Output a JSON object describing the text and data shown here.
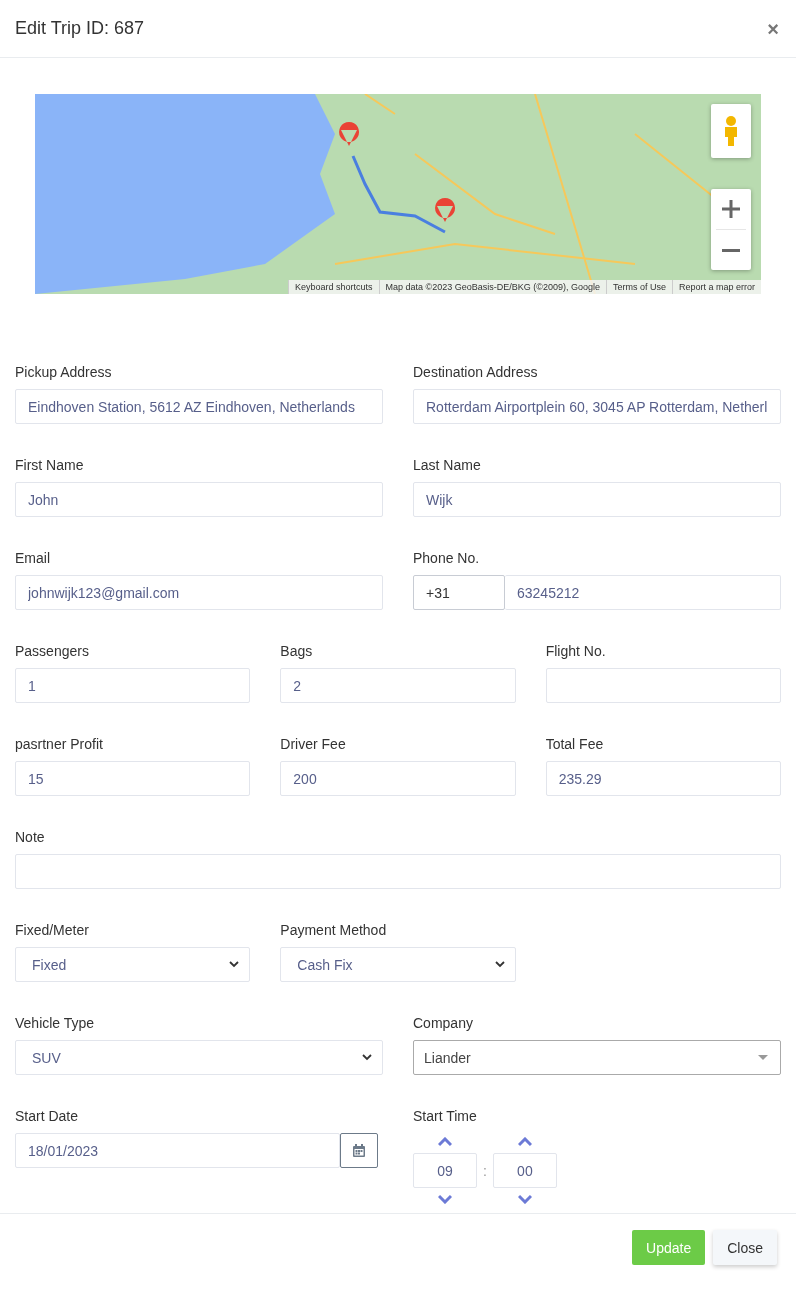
{
  "dialog": {
    "title": "Edit Trip ID: 687",
    "close": "×"
  },
  "map": {
    "attribution": [
      "Keyboard shortcuts",
      "Map data ©2023 GeoBasis-DE/BKG (©2009), Google",
      "Terms of Use",
      "Report a map error"
    ]
  },
  "rows": [
    [
      {
        "label": "Pickup Address",
        "kind": "text",
        "value": "Eindhoven Station, 5612 AZ Eindhoven, Netherlands"
      },
      {
        "label": "Destination Address",
        "kind": "text",
        "value": "Rotterdam Airportplein 60, 3045 AP Rotterdam, Netherl"
      }
    ],
    [
      {
        "label": "First Name",
        "kind": "text",
        "value": "John"
      },
      {
        "label": "Last Name",
        "kind": "text",
        "value": "Wijk"
      }
    ],
    [
      {
        "label": "Email",
        "kind": "text",
        "value": "johnwijk123@gmail.com"
      },
      {
        "label": "Phone No.",
        "kind": "phone",
        "code": "+31",
        "value": "63245212"
      }
    ],
    [
      {
        "label": "Passengers",
        "kind": "text",
        "value": "1"
      },
      {
        "label": "Bags",
        "kind": "text",
        "value": "2"
      },
      {
        "label": "Flight No.",
        "kind": "text"
      }
    ],
    [
      {
        "label": "pasrtner Profit",
        "kind": "text",
        "value": "15"
      },
      {
        "label": "Driver Fee",
        "kind": "text",
        "value": "200"
      },
      {
        "label": "Total Fee",
        "kind": "text",
        "value": "235.29"
      }
    ],
    [
      {
        "label": "Note",
        "kind": "text"
      }
    ],
    [
      {
        "label": "Fixed/Meter",
        "kind": "select",
        "value": "Fixed"
      },
      {
        "label": "Payment Method",
        "kind": "select",
        "value": "Cash Fix"
      }
    ],
    [
      {
        "label": "Vehicle Type",
        "kind": "select",
        "value": "SUV"
      },
      {
        "label": "Company",
        "kind": "combo",
        "value": "Liander"
      }
    ],
    [
      {
        "label": "Start Date",
        "kind": "date",
        "value": "18/01/2023"
      },
      {
        "label": "Start Time",
        "kind": "time",
        "hours": "09",
        "separator": ":",
        "minutes": "00"
      }
    ]
  ],
  "buttons": [
    {
      "label": "Update",
      "kind": "primary"
    },
    {
      "label": "Close",
      "kind": "secondary"
    }
  ]
}
